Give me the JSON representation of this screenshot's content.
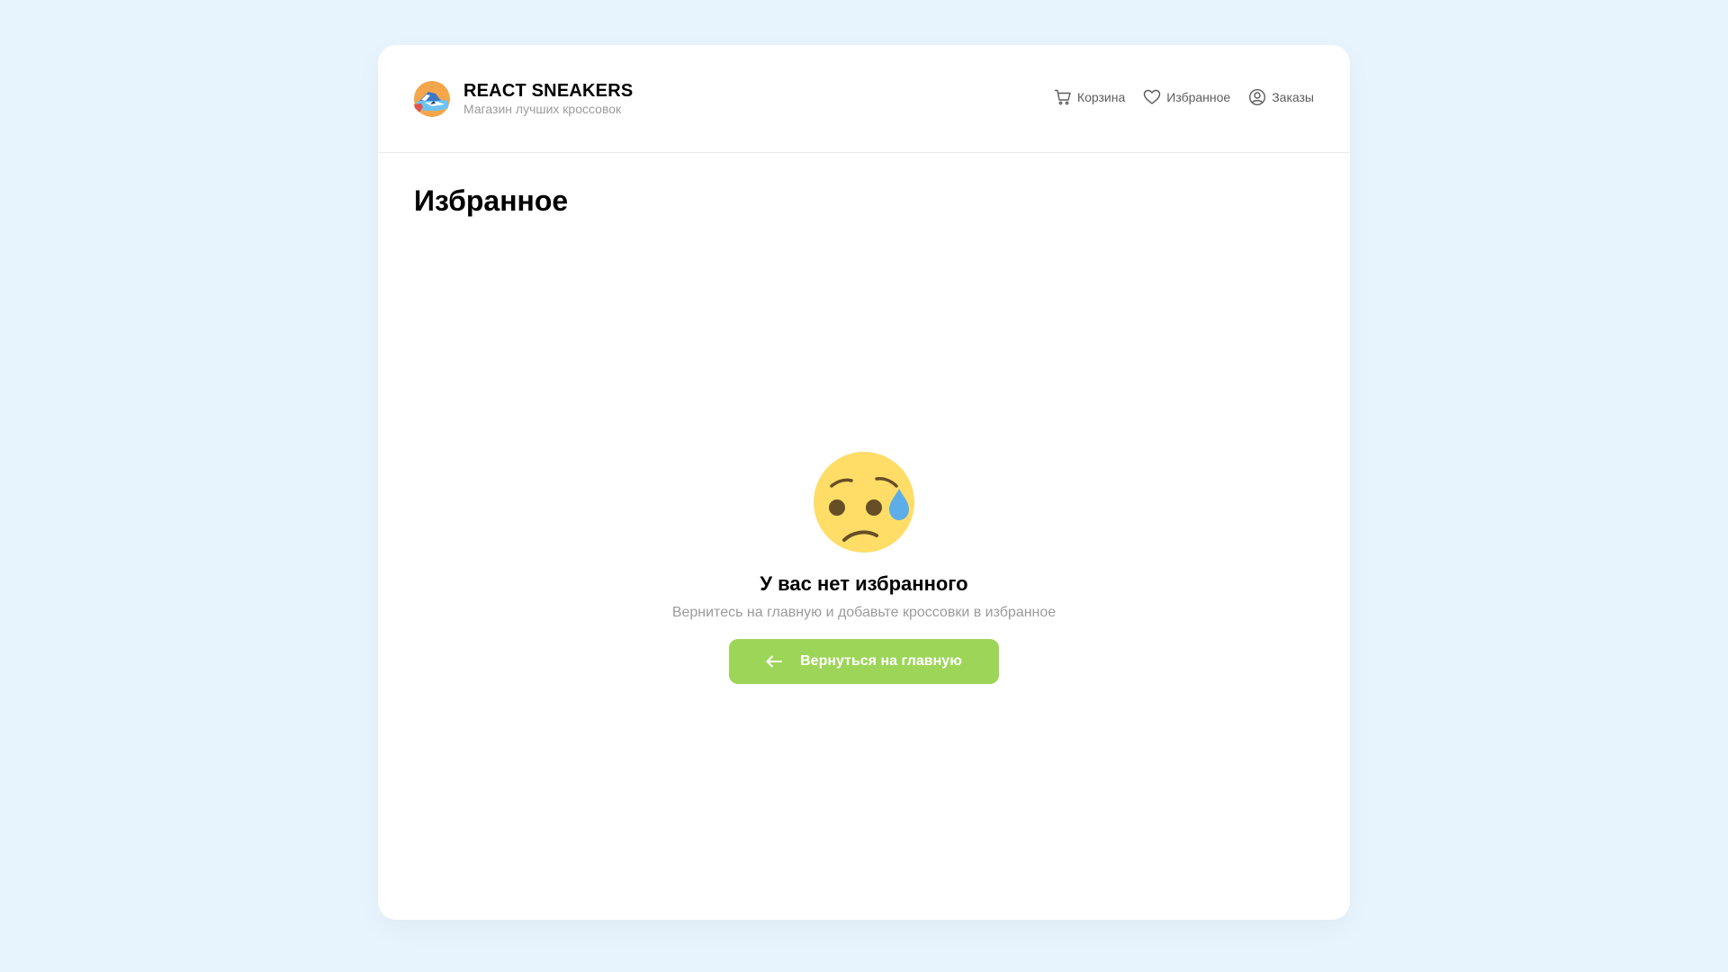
{
  "header": {
    "brand": "REACT SNEAKERS",
    "tagline": "Магазин лучших кроссовок",
    "logo_icon": "sneaker-logo-icon",
    "nav": {
      "cart": {
        "label": "Корзина",
        "icon": "cart-icon"
      },
      "favorites": {
        "label": "Избранное",
        "icon": "heart-icon"
      },
      "orders": {
        "label": "Заказы",
        "icon": "user-icon"
      }
    }
  },
  "page": {
    "title": "Избранное"
  },
  "empty_state": {
    "icon": "sad-face-emoji-icon",
    "title": "У вас нет избранного",
    "subtitle": "Вернитесь на главную и добавьте кроссовки в избранное",
    "button_label": "Вернуться на главную",
    "button_icon": "arrow-left-icon"
  },
  "colors": {
    "background": "#e7f4fd",
    "accent_button": "#9dd558",
    "muted_text": "#9b9b9b"
  }
}
